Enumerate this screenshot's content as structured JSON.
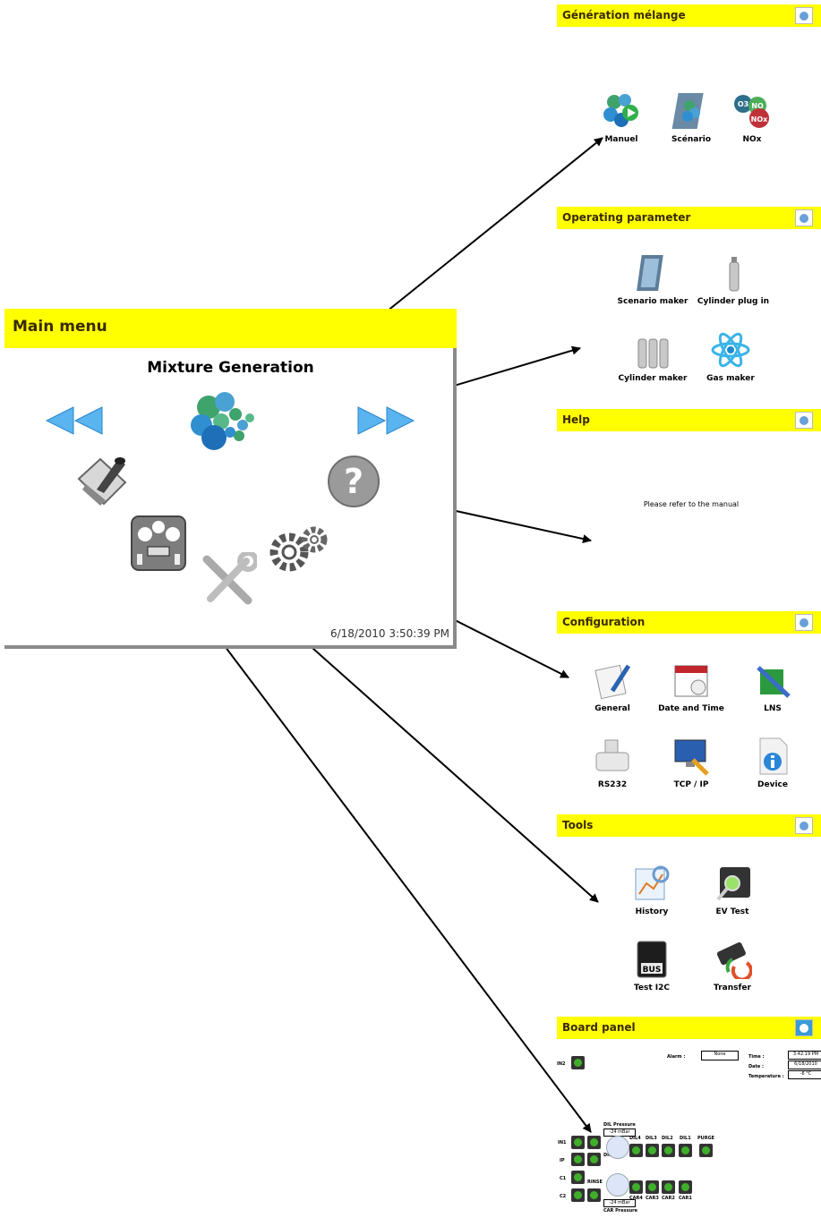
{
  "main_window": {
    "title": "Main menu",
    "mode_title": "Mixture Generation",
    "datetime": "6/18/2010 3:50:39 PM",
    "icons": [
      "prev-arrows-icon",
      "mixture-generation-icon",
      "next-arrows-icon",
      "operating-parameter-icon",
      "help-icon",
      "board-panel-icon",
      "tools-icon",
      "configuration-icon"
    ]
  },
  "panels": {
    "generation": {
      "title": "Génération mélange",
      "items": [
        {
          "label": "Manuel",
          "icon": "molecule-play-icon"
        },
        {
          "label": "Scénario",
          "icon": "molecule-film-icon"
        },
        {
          "label": "NOx",
          "icon": "nox-icon"
        }
      ],
      "nox_bubbles": [
        "O3",
        "NO",
        "NOx"
      ]
    },
    "operating": {
      "title": "Operating parameter",
      "items": [
        {
          "label": "Scenario maker",
          "icon": "film-strip-icon"
        },
        {
          "label": "Cylinder plug in",
          "icon": "cylinder-icon"
        },
        {
          "label": "Cylinder maker",
          "icon": "cylinders-icon"
        },
        {
          "label": "Gas maker",
          "icon": "atom-icon"
        }
      ]
    },
    "help": {
      "title": "Help",
      "text": "Please refer to the manual"
    },
    "configuration": {
      "title": "Configuration",
      "items": [
        {
          "label": "General",
          "icon": "document-pen-icon"
        },
        {
          "label": "Date and Time",
          "icon": "calendar-icon"
        },
        {
          "label": "LNS",
          "icon": "circuit-icon"
        },
        {
          "label": "RS232",
          "icon": "serial-port-icon"
        },
        {
          "label": "TCP / IP",
          "icon": "network-computer-icon"
        },
        {
          "label": "Device",
          "icon": "device-info-icon"
        }
      ]
    },
    "tools": {
      "title": "Tools",
      "items": [
        {
          "label": "History",
          "icon": "history-chart-icon"
        },
        {
          "label": "EV Test",
          "icon": "ev-test-icon"
        },
        {
          "label": "Test I2C",
          "icon": "bus-chip-icon"
        },
        {
          "label": "Transfer",
          "icon": "usb-transfer-icon"
        }
      ],
      "bus_text": "BUS"
    },
    "board": {
      "title": "Board panel",
      "in2": "IN2",
      "alarm_label": "Alarm :",
      "alarm_value": "None",
      "time_label": "Time :",
      "time_value": "3:42:19 PM",
      "date_label": "Date :",
      "date_value": "6/18/2010",
      "temp_label": "Temperature :",
      "temp_value": "-6 °C",
      "dil_pressure_label": "DIL Pressure",
      "dil_pressure_value": "-24 mBar",
      "dil": "DIL",
      "dil_labels": [
        "DIL4",
        "DIL3",
        "DIL2",
        "DIL1",
        "PURGE"
      ],
      "left_labels": [
        "IN1",
        "IP",
        "C1",
        "C2"
      ],
      "rinse": "RINSE",
      "car_labels": [
        "CAR4",
        "CAR3",
        "CAR2",
        "CAR1"
      ],
      "car_pressure_value": "-24 mBar",
      "car_pressure_label": "CAR Pressure"
    }
  }
}
